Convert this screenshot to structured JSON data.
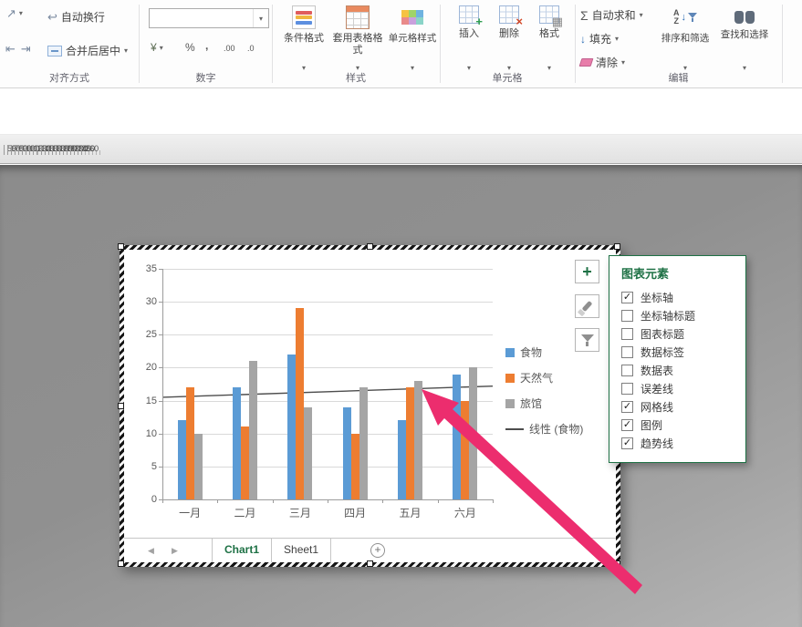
{
  "colors": {
    "accent_green": "#1e7145",
    "series_blue": "#5b9bd5",
    "series_orange": "#ed7d31",
    "series_gray": "#a5a5a5",
    "trendline": "#4d4d4d",
    "arrow_pink": "#ec2d6e"
  },
  "icons": {
    "orientation": "↗",
    "decrease_indent": "⇤",
    "increase_indent": "⇥",
    "wrap": "↩",
    "caret": "▾",
    "autosum": "Σ",
    "fill_arrow": "↓",
    "currency": "¥",
    "percent": "%",
    "comma": ",",
    "inc_decimal": ".00",
    "dec_decimal": ".0",
    "sort_a": "A",
    "sort_z": "Z",
    "sort_arrow": "↓",
    "nav_left": "◀",
    "nav_right": "▶",
    "add_sheet": "+",
    "plus": "+",
    "check": "✓"
  },
  "ribbon": {
    "alignment": {
      "label": "对齐方式",
      "wrap_text": "自动换行",
      "merge_center": "合并后居中"
    },
    "number": {
      "label": "数字",
      "format_value": ""
    },
    "styles": {
      "label": "样式",
      "conditional": "条件格式",
      "format_as_table": "套用表格格式",
      "cell_styles": "单元格样式"
    },
    "cells": {
      "label": "单元格",
      "insert": "插入",
      "delete": "删除",
      "format": "格式"
    },
    "editing": {
      "label": "编辑",
      "autosum": "自动求和",
      "fill": "填充",
      "clear": "清除",
      "sort_filter": "排序和筛选",
      "find_select": "查找和选择"
    }
  },
  "ruler": {
    "ticks": [
      50,
      60,
      70,
      80,
      90,
      100,
      110,
      120,
      130,
      140,
      150,
      160,
      170,
      180,
      190,
      200,
      210,
      220,
      230,
      240,
      250,
      260
    ]
  },
  "chart_data": {
    "type": "bar",
    "title": "",
    "categories": [
      "一月",
      "二月",
      "三月",
      "四月",
      "五月",
      "六月"
    ],
    "series": [
      {
        "name": "食物",
        "color": "#5b9bd5",
        "values": [
          12,
          17,
          22,
          14,
          12,
          19
        ]
      },
      {
        "name": "天然气",
        "color": "#ed7d31",
        "values": [
          17,
          11,
          29,
          10,
          17,
          15
        ]
      },
      {
        "name": "旅馆",
        "color": "#a5a5a5",
        "values": [
          10,
          21,
          14,
          17,
          18,
          20
        ]
      }
    ],
    "trendline": {
      "name": "线性 (食物)",
      "start_value": 15.5,
      "end_value": 17.2,
      "color": "#4d4d4d"
    },
    "ylim": [
      0,
      35
    ],
    "ytick_step": 5,
    "gridlines": true,
    "legend_position": "right"
  },
  "chart_tools": {
    "panel": {
      "title": "图表元素",
      "items": [
        {
          "label": "坐标轴",
          "checked": true
        },
        {
          "label": "坐标轴标题",
          "checked": false
        },
        {
          "label": "图表标题",
          "checked": false
        },
        {
          "label": "数据标签",
          "checked": false
        },
        {
          "label": "数据表",
          "checked": false
        },
        {
          "label": "误差线",
          "checked": false
        },
        {
          "label": "网格线",
          "checked": true
        },
        {
          "label": "图例",
          "checked": true
        },
        {
          "label": "趋势线",
          "checked": true
        }
      ]
    }
  },
  "sheet_bar": {
    "tabs": [
      {
        "name": "Chart1",
        "active": true
      },
      {
        "name": "Sheet1",
        "active": false
      }
    ]
  }
}
